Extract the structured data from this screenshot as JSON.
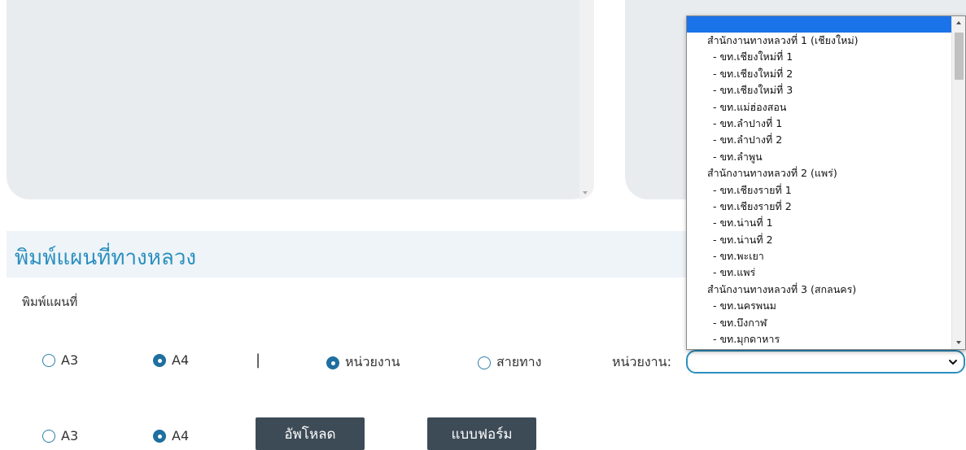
{
  "section": {
    "title": "พิมพ์แผนที่ทางหลวง",
    "subtitle": "พิมพ์แผนที่"
  },
  "row1": {
    "size_a3": "A3",
    "size_a4": "A4",
    "separator": "|",
    "mode_unit": "หน่วยงาน",
    "mode_route": "สายทาง",
    "unit_label": "หน่วยงาน:",
    "selected_size": "A4",
    "selected_mode": "หน่วยงาน"
  },
  "row2": {
    "size_a3": "A3",
    "size_a4": "A4",
    "selected_size": "A4",
    "upload_button": "อัพโหลด",
    "form_button": "แบบฟอร์ม"
  },
  "unit_select": {
    "value": "",
    "options": [
      {
        "label": "สำนักงานทางหลวงที่ 1 (เชียงใหม่)",
        "kind": "group"
      },
      {
        "label": "- ขท.เชียงใหม่ที่ 1",
        "kind": "child"
      },
      {
        "label": "- ขท.เชียงใหม่ที่ 2",
        "kind": "child"
      },
      {
        "label": "- ขท.เชียงใหม่ที่ 3",
        "kind": "child"
      },
      {
        "label": "- ขท.แม่ฮ่องสอน",
        "kind": "child"
      },
      {
        "label": "- ขท.ลำปางที่ 1",
        "kind": "child"
      },
      {
        "label": "- ขท.ลำปางที่ 2",
        "kind": "child"
      },
      {
        "label": "- ขท.ลำพูน",
        "kind": "child"
      },
      {
        "label": "สำนักงานทางหลวงที่ 2 (แพร่)",
        "kind": "group"
      },
      {
        "label": "- ขท.เชียงรายที่ 1",
        "kind": "child"
      },
      {
        "label": "- ขท.เชียงรายที่ 2",
        "kind": "child"
      },
      {
        "label": "- ขท.น่านที่ 1",
        "kind": "child"
      },
      {
        "label": "- ขท.น่านที่ 2",
        "kind": "child"
      },
      {
        "label": "- ขท.พะเยา",
        "kind": "child"
      },
      {
        "label": "- ขท.แพร่",
        "kind": "child"
      },
      {
        "label": "สำนักงานทางหลวงที่ 3 (สกลนคร)",
        "kind": "group"
      },
      {
        "label": "- ขท.นครพนม",
        "kind": "child"
      },
      {
        "label": "- ขท.บึงกาฬ",
        "kind": "child"
      },
      {
        "label": "- ขท.มุกดาหาร",
        "kind": "child"
      }
    ]
  },
  "colors": {
    "accent": "#2b8fbf",
    "button_bg": "#3d4b57",
    "selected_option": "#1a73e8",
    "panel_bg": "#e9ecef"
  }
}
